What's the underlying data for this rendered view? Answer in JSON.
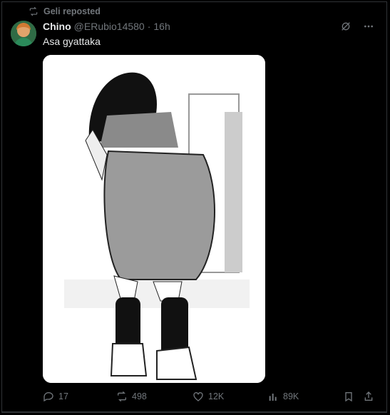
{
  "colors": {
    "background": "#000000",
    "text_primary": "#e7e9ea",
    "text_secondary": "#71767b",
    "border": "#2f3336"
  },
  "repost": {
    "icon": "repost-icon",
    "label": "Geli reposted"
  },
  "author": {
    "avatar": "avatar",
    "name": "Chino",
    "handle": "@ERubio14580",
    "separator": "·",
    "time": "16h"
  },
  "header_icons": [
    "grok-icon",
    "more-icon"
  ],
  "tweet": {
    "text": "Asa gyattaka",
    "media": "manga-illustration-image"
  },
  "actions": {
    "reply": {
      "icon": "reply-icon",
      "count": "17"
    },
    "repost": {
      "icon": "repost-icon",
      "count": "498"
    },
    "like": {
      "icon": "heart-icon",
      "count": "12K"
    },
    "views": {
      "icon": "views-icon",
      "count": "89K"
    },
    "bookmark": {
      "icon": "bookmark-icon"
    },
    "share": {
      "icon": "share-icon"
    }
  }
}
